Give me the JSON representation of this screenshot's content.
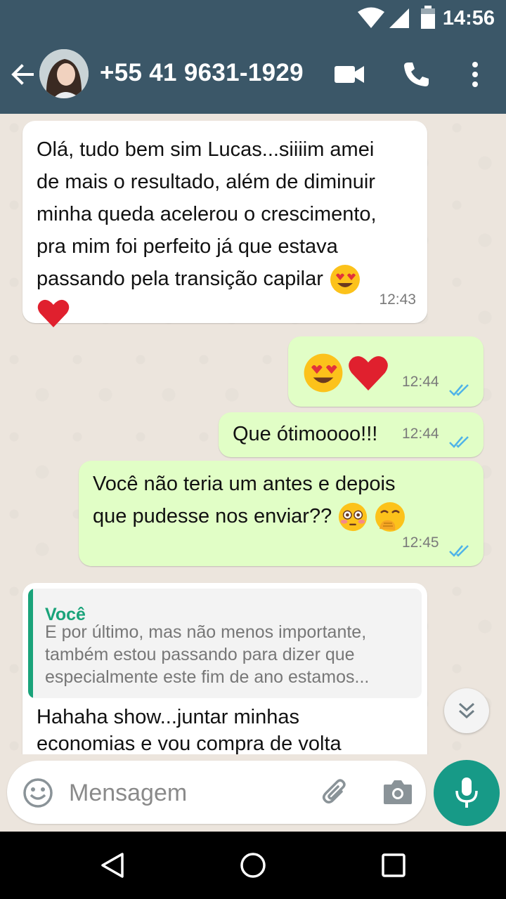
{
  "status_bar": {
    "time": "14:56"
  },
  "header": {
    "contact_name": "+55 41 9631-1929"
  },
  "messages": [
    {
      "direction": "incoming",
      "lines": [
        "Olá, tudo bem sim Lucas...siiiim amei",
        "de mais o resultado, além de diminuir",
        "minha queda acelerou o crescimento,",
        "pra mim foi perfeito já que estava",
        "passando pela transição capilar"
      ],
      "emojis": [
        "heart-eyes",
        "red-heart"
      ],
      "time": "12:43"
    },
    {
      "direction": "outgoing",
      "text": "",
      "emojis": [
        "heart-eyes",
        "red-heart"
      ],
      "time": "12:44",
      "status": "read"
    },
    {
      "direction": "outgoing",
      "text": "Que ótimoooo!!!",
      "time": "12:44",
      "status": "read"
    },
    {
      "direction": "outgoing",
      "lines": [
        "Você não teria um antes e depois",
        "que pudesse nos enviar??"
      ],
      "emojis": [
        "flushed",
        "hand-over-mouth"
      ],
      "time": "12:45",
      "status": "read"
    },
    {
      "direction": "incoming",
      "quote": {
        "author": "Você",
        "lines": [
          "E por último, mas não menos importante,",
          "também estou passando para dizer que",
          "especialmente este fim de ano estamos..."
        ]
      },
      "lines": [
        "Hahaha show...juntar minhas",
        "economias e vou compra de volta"
      ]
    }
  ],
  "input": {
    "placeholder": "Mensagem"
  },
  "icons": {
    "back": "arrow-left-icon",
    "video": "videocam-icon",
    "call": "phone-icon",
    "menu": "more-vert-icon",
    "emoji": "emoji-icon",
    "attach": "paperclip-icon",
    "camera": "camera-icon",
    "mic": "mic-icon",
    "scroll": "chevron-double-down-icon"
  },
  "colors": {
    "header": "#3b5768",
    "outgoing_bubble": "#e1fec6",
    "accent": "#179a87",
    "read_ticks": "#4fb3e8"
  }
}
